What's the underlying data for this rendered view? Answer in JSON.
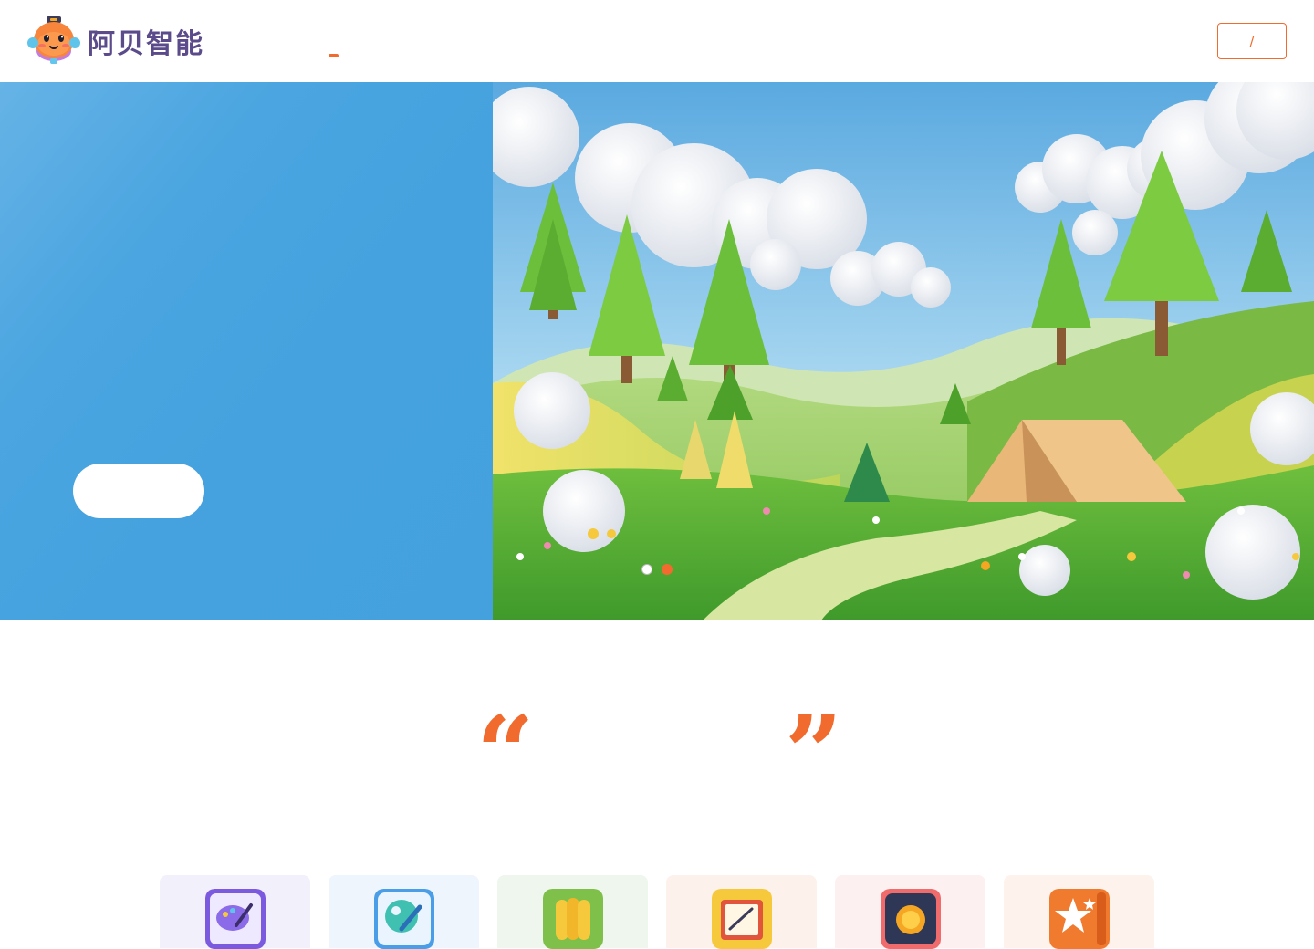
{
  "header": {
    "brand_name": "阿贝智能",
    "lang_toggle_label": "/",
    "accent_color": "#f26b2e"
  },
  "hero": {
    "background_color": "#44a1dd",
    "carousel": {
      "slide_count": 2,
      "active_index": 1
    }
  },
  "quote": {
    "open_mark": "“",
    "close_mark": "”"
  },
  "cards": [
    {
      "icon": "palette-brush-icon",
      "bg": "#f1f0fb"
    },
    {
      "icon": "planet-edit-icon",
      "bg": "#eef5fc"
    },
    {
      "icon": "corn-icon",
      "bg": "#eff6ee"
    },
    {
      "icon": "drawing-board-icon",
      "bg": "#fdf1ec"
    },
    {
      "icon": "sunrise-icon",
      "bg": "#fdf0f1"
    },
    {
      "icon": "magic-star-icon",
      "bg": "#fdf2ec"
    }
  ]
}
